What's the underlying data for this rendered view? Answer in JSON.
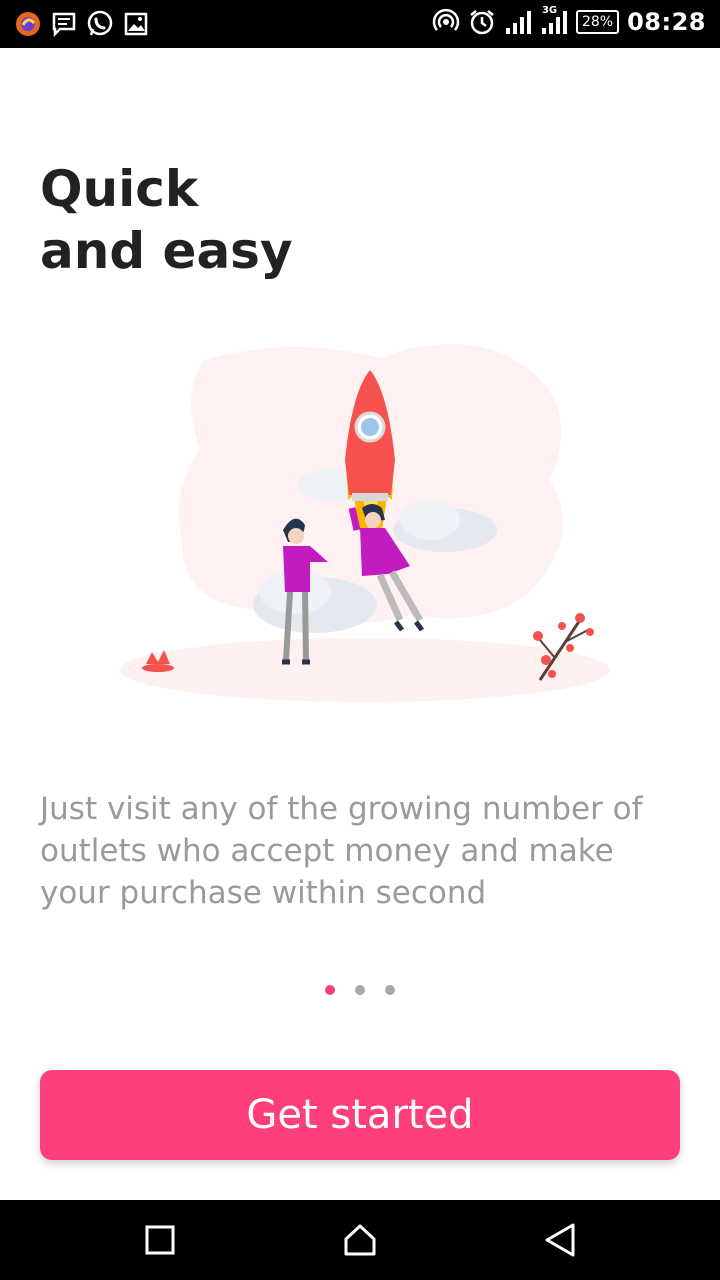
{
  "status_bar": {
    "left_icons": [
      "browser-icon",
      "message-icon",
      "whatsapp-icon",
      "gallery-icon"
    ],
    "right_icons": [
      "hotspot-icon",
      "alarm-icon",
      "signal-icon",
      "signal-3g-icon"
    ],
    "network_label": "3G",
    "battery": "28%",
    "time": "08:28"
  },
  "onboarding": {
    "headline_line1": "Quick",
    "headline_line2": "and easy",
    "illustration": "rocket-launch-illustration",
    "description": "Just visit any of the growing number of outlets who accept money and make your purchase within second",
    "pager": {
      "total": 3,
      "active": 1
    },
    "cta_label": "Get started"
  },
  "nav_bar": {
    "icons": [
      "recents-icon",
      "home-icon",
      "back-icon"
    ]
  },
  "colors": {
    "accent": "#ff3f7c",
    "headline": "#222222",
    "body_text": "#9a9a9a",
    "dot_inactive": "#a8a8a8"
  }
}
